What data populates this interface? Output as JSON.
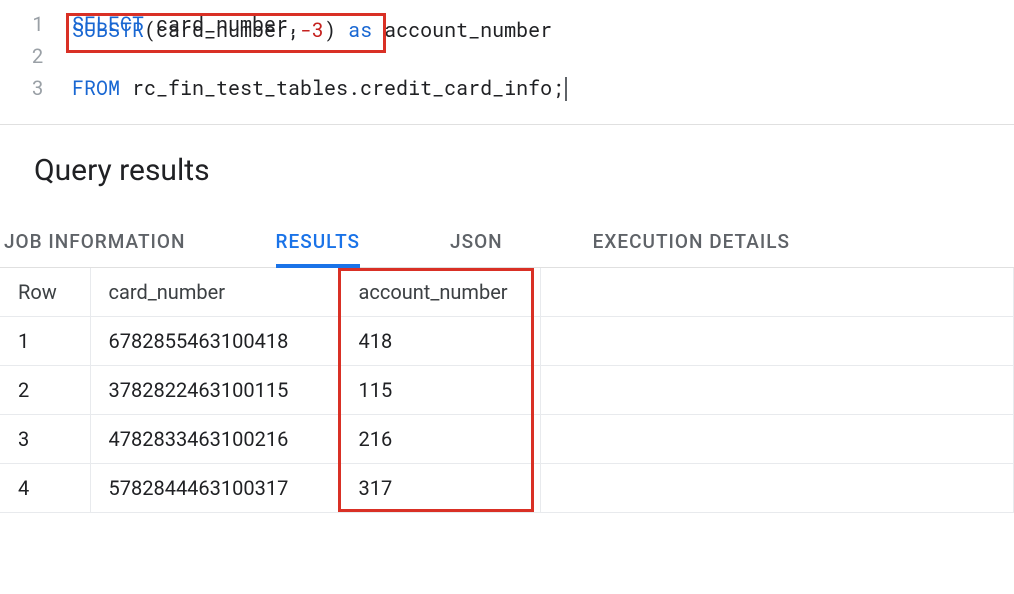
{
  "editor": {
    "lines": [
      {
        "num": "1",
        "parts": {
          "kw1": "SELECT",
          "t1": " card_number,"
        }
      },
      {
        "num": "2",
        "parts": {
          "fn1": "SUBSTR",
          "p1": "(card_number,",
          "n1": "-3",
          "p2": ") ",
          "kw2": "as",
          "t2": " account_number"
        }
      },
      {
        "num": "3",
        "parts": {
          "kw3": "FROM",
          "t3": " rc_fin_test_tables.credit_card_info;"
        }
      }
    ]
  },
  "results": {
    "title": "Query results",
    "tabs": {
      "job_info": "JOB INFORMATION",
      "results": "RESULTS",
      "json": "JSON",
      "exec": "EXECUTION DETAILS"
    },
    "headers": {
      "row": "Row",
      "card_number": "card_number",
      "account_number": "account_number"
    },
    "rows": [
      {
        "row": "1",
        "card_number": "6782855463100418",
        "account_number": "418"
      },
      {
        "row": "2",
        "card_number": "3782822463100115",
        "account_number": "115"
      },
      {
        "row": "3",
        "card_number": "4782833463100216",
        "account_number": "216"
      },
      {
        "row": "4",
        "card_number": "5782844463100317",
        "account_number": "317"
      }
    ]
  },
  "chart_data": {
    "type": "table",
    "title": "Query results",
    "columns": [
      "Row",
      "card_number",
      "account_number"
    ],
    "data": [
      [
        1,
        "6782855463100418",
        "418"
      ],
      [
        2,
        "3782822463100115",
        "115"
      ],
      [
        3,
        "4782833463100216",
        "216"
      ],
      [
        4,
        "5782844463100317",
        "317"
      ]
    ]
  }
}
